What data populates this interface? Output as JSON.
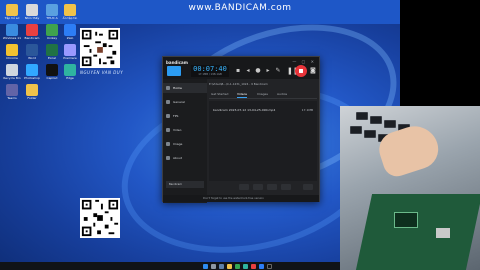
{
  "watermark": "www.BANDICAM.com",
  "desktop_icons": [
    {
      "label": "Tập hồ sơ",
      "color": "#f0c24a"
    },
    {
      "label": "Nhìn thấy",
      "color": "#d9d9d9"
    },
    {
      "label": "THUC A",
      "color": "#5aa0e0"
    },
    {
      "label": "Ẩn tập tin",
      "color": "#f0c24a"
    },
    {
      "label": "Windows 11",
      "color": "#3a8be0"
    },
    {
      "label": "Bandicam",
      "color": "#e94040"
    },
    {
      "label": "Unikey",
      "color": "#3fa34d"
    },
    {
      "label": "Zalo",
      "color": "#2d7df6"
    },
    {
      "label": "Chrome",
      "color": "#f2c230"
    },
    {
      "label": "Word",
      "color": "#2b579a"
    },
    {
      "label": "Excel",
      "color": "#207245"
    },
    {
      "label": "Premiere",
      "color": "#9999ff"
    },
    {
      "label": "Recycle Bin",
      "color": "#cfd6de"
    },
    {
      "label": "Photoshop",
      "color": "#31a8ff"
    },
    {
      "label": "CapCut",
      "color": "#111111"
    },
    {
      "label": "Edge",
      "color": "#2fb4a0"
    },
    {
      "label": "Teams",
      "color": "#6264a7"
    },
    {
      "label": "Folder",
      "color": "#f0c24a"
    }
  ],
  "qr_caption": "NGUYEN VAN DUY",
  "bandicam": {
    "logo": "bandicam",
    "timer": "00:07:40",
    "size": "17.1MB / 198.1GB",
    "window_buttons": "— ▢ ✕",
    "sidebar": [
      {
        "label": "Home"
      },
      {
        "label": "General"
      },
      {
        "label": "FPS"
      },
      {
        "label": "Video"
      },
      {
        "label": "Image"
      },
      {
        "label": "About"
      }
    ],
    "path": "E:\\Video\\B...\\C-1-1231_1024 - 9 Bandicam",
    "tabs": [
      "Get Started",
      "Videos",
      "Images",
      "Audios"
    ],
    "file_name": "bandicam 2023-07-12 13-04-25-090.mp4",
    "file_size": "17.1MB",
    "side_bottom": "Bandicam",
    "footer": "Don't forget to use the watermark-free version"
  }
}
